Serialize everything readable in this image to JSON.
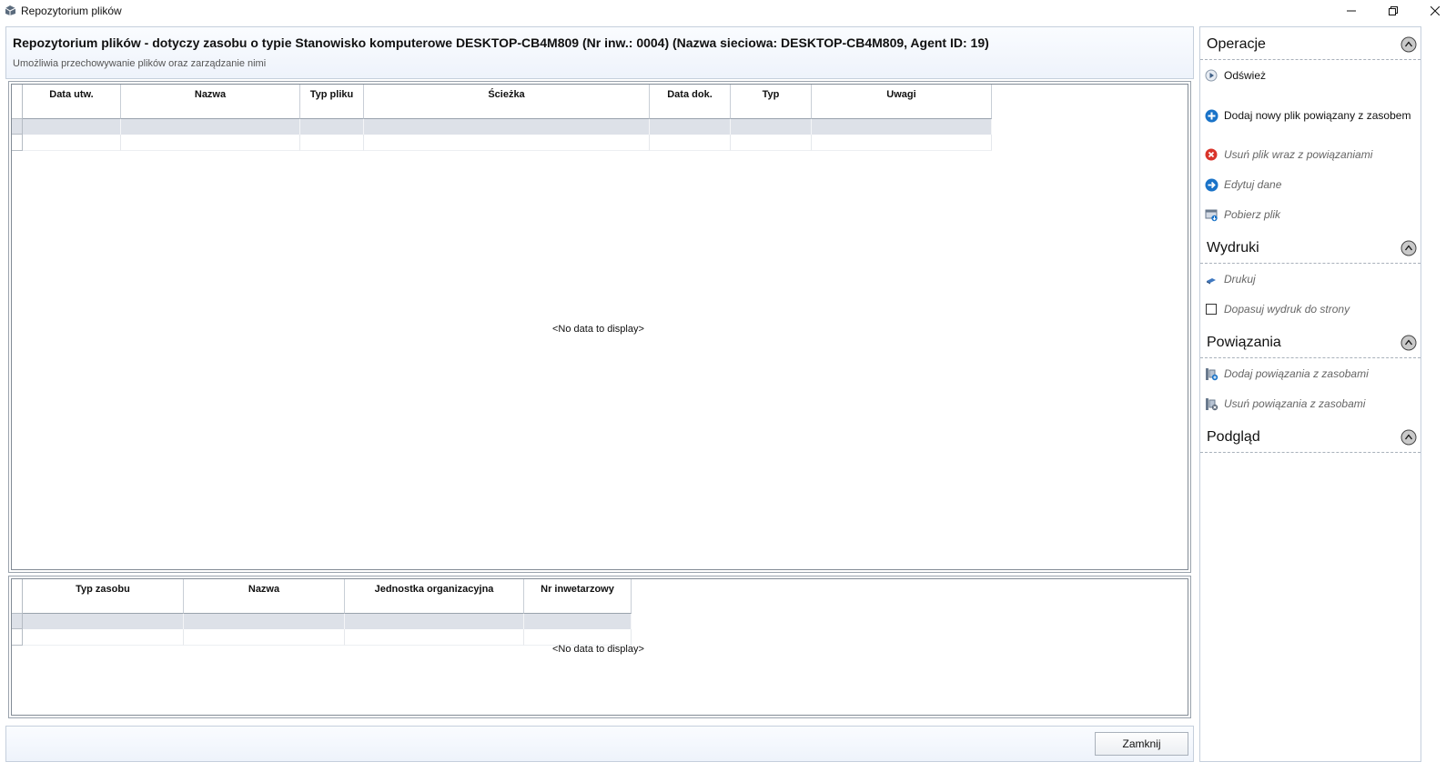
{
  "window": {
    "title": "Repozytorium plików",
    "minimize_label": "",
    "maximize_label": "",
    "close_label": ""
  },
  "header": {
    "title": "Repozytorium plików - dotyczy zasobu o typie Stanowisko komputerowe DESKTOP-CB4M809 (Nr inw.: 0004) (Nazwa sieciowa: DESKTOP-CB4M809, Agent ID: 19)",
    "subtitle": "Umożliwia przechowywanie plików oraz zarządzanie nimi"
  },
  "files_grid": {
    "columns": [
      "Data utw.",
      "Nazwa",
      "Typ pliku",
      "Ścieżka",
      "Data dok.",
      "Typ",
      "Uwagi"
    ],
    "empty_text": "<No data to display>"
  },
  "resources_grid": {
    "columns": [
      "Typ zasobu",
      "Nazwa",
      "Jednostka organizacyjna",
      "Nr inwetarzowy"
    ],
    "empty_text": "<No data to display>"
  },
  "footer": {
    "close_button": "Zamknij"
  },
  "side_panel": {
    "sections": [
      {
        "title": "Operacje",
        "items": [
          {
            "label": "Odśwież",
            "icon": "play-icon",
            "enabled": true
          },
          {
            "label": "Dodaj nowy plik powiązany z zasobem",
            "icon": "add-icon",
            "enabled": true
          },
          {
            "label": "Usuń plik wraz z powiązaniami",
            "icon": "delete-icon",
            "enabled": false
          },
          {
            "label": "Edytuj dane",
            "icon": "edit-arrow-icon",
            "enabled": false
          },
          {
            "label": "Pobierz plik",
            "icon": "download-icon",
            "enabled": false
          }
        ]
      },
      {
        "title": "Wydruki",
        "items": [
          {
            "label": "Drukuj",
            "icon": "print-icon",
            "enabled": false
          },
          {
            "label": "Dopasuj wydruk do strony",
            "icon": "checkbox",
            "enabled": false,
            "checked": false
          }
        ]
      },
      {
        "title": "Powiązania",
        "items": [
          {
            "label": "Dodaj powiązania z zasobami",
            "icon": "link-add-icon",
            "enabled": false
          },
          {
            "label": "Usuń powiązania z zasobami",
            "icon": "link-remove-icon",
            "enabled": false
          }
        ]
      },
      {
        "title": "Podgląd",
        "items": []
      }
    ]
  },
  "colors": {
    "accent_blue": "#1a73c8",
    "delete_red": "#d9342b",
    "filter_row": "#dde1e8"
  }
}
